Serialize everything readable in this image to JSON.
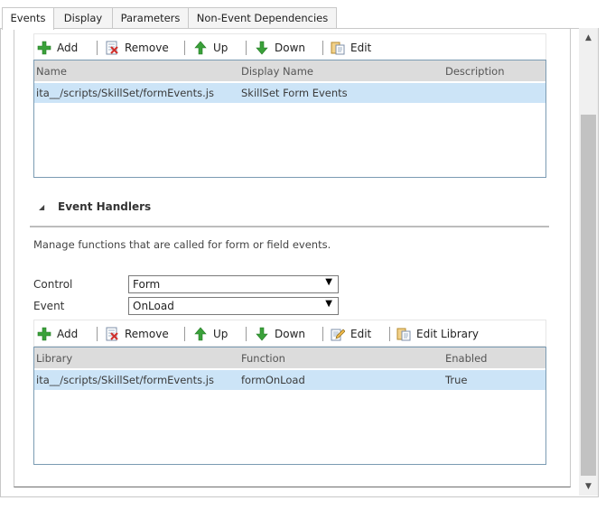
{
  "tabs": [
    {
      "label": "Events"
    },
    {
      "label": "Display"
    },
    {
      "label": "Parameters"
    },
    {
      "label": "Non-Event Dependencies"
    }
  ],
  "libraries_toolbar": {
    "add": "Add",
    "remove": "Remove",
    "up": "Up",
    "down": "Down",
    "edit": "Edit"
  },
  "libraries_grid": {
    "columns": [
      "Name",
      "Display Name",
      "Description"
    ],
    "rows": [
      {
        "name": "ita__/scripts/SkillSet/formEvents.js",
        "display_name": "SkillSet Form Events",
        "description": ""
      }
    ]
  },
  "event_handlers": {
    "title": "Event Handlers",
    "description": "Manage functions that are called for form or field events.",
    "control_label": "Control",
    "control_value": "Form",
    "event_label": "Event",
    "event_value": "OnLoad"
  },
  "handlers_toolbar": {
    "add": "Add",
    "remove": "Remove",
    "up": "Up",
    "down": "Down",
    "edit": "Edit",
    "edit_library": "Edit Library"
  },
  "handlers_grid": {
    "columns": [
      "Library",
      "Function",
      "Enabled"
    ],
    "rows": [
      {
        "library": "ita__/scripts/SkillSet/formEvents.js",
        "function": "formOnLoad",
        "enabled": "True"
      }
    ]
  },
  "colors": {
    "selected_row": "#cce4f7",
    "grid_header": "#dcdcdc",
    "grid_border": "#7b9bb3",
    "add_icon": "#3aa13a",
    "arrow_icon": "#3aa13a",
    "remove_icon": "#d0312d"
  },
  "icons": [
    "plus-icon",
    "remove-icon",
    "arrow-up-icon",
    "arrow-down-icon",
    "edit-icon",
    "edit-pencil-icon",
    "edit-library-icon"
  ]
}
